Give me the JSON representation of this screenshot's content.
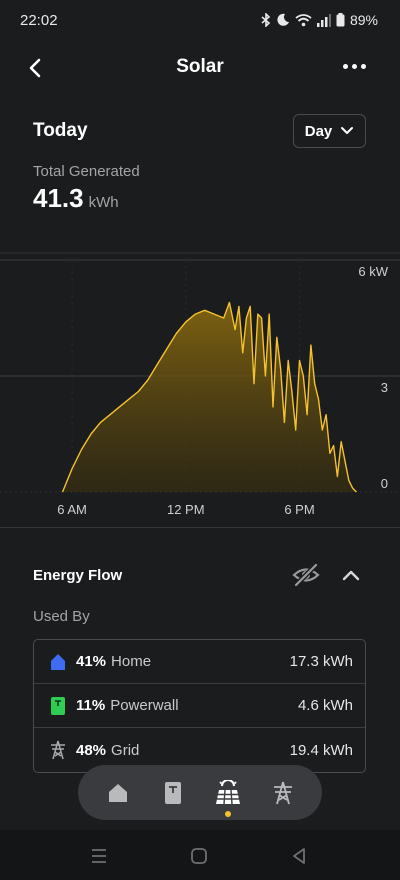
{
  "status_bar": {
    "time": "22:02",
    "battery": "89%",
    "icons": [
      "bluetooth-icon",
      "moon-icon",
      "wifi-icon",
      "signal-icon",
      "battery-icon"
    ]
  },
  "header": {
    "title": "Solar",
    "back_icon": "chevron-left-icon",
    "more_icon": "more-horizontal-icon"
  },
  "summary": {
    "period_title": "Today",
    "period_select": "Day",
    "total_label": "Total Generated",
    "total_value": "41.3",
    "total_unit": "kWh"
  },
  "chart_data": {
    "type": "area",
    "title": "",
    "xlabel": "",
    "ylabel": "",
    "x_ticks": [
      "6 AM",
      "12 PM",
      "6 PM"
    ],
    "y_ticks": [
      "0",
      "3",
      "6 kW"
    ],
    "ylim": [
      0,
      6
    ],
    "xlim_hours": [
      2.2,
      23.3
    ],
    "grid": true,
    "color": "#f5c22e",
    "series": [
      {
        "x": [
          5.5,
          6.0,
          6.5,
          7.0,
          7.5,
          8.0,
          8.5,
          9.0,
          9.5,
          10.0,
          10.5,
          11.0,
          11.5,
          12.0,
          12.5,
          13.0,
          13.5,
          14.0,
          14.3,
          14.6,
          14.8,
          15.0,
          15.2,
          15.4,
          15.6,
          15.8,
          16.0,
          16.2,
          16.4,
          16.6,
          16.8,
          17.0,
          17.2,
          17.4,
          17.6,
          17.8,
          18.0,
          18.2,
          18.4,
          18.6,
          18.8,
          19.0,
          19.2,
          19.4,
          19.6,
          19.8,
          20.0,
          20.2,
          20.4,
          20.6,
          20.8,
          21.0
        ],
        "values": [
          0.0,
          0.6,
          1.1,
          1.5,
          1.8,
          2.0,
          2.2,
          2.4,
          2.6,
          2.9,
          3.3,
          3.7,
          4.1,
          4.4,
          4.6,
          4.7,
          4.6,
          4.5,
          4.9,
          4.2,
          4.8,
          3.6,
          4.5,
          4.8,
          2.8,
          4.6,
          4.5,
          3.0,
          4.6,
          2.2,
          4.0,
          3.2,
          1.8,
          3.4,
          2.6,
          1.6,
          3.4,
          3.0,
          2.0,
          3.8,
          2.8,
          2.4,
          1.6,
          2.0,
          1.0,
          1.2,
          0.4,
          1.3,
          0.8,
          0.3,
          0.1,
          0.0
        ]
      }
    ]
  },
  "energy_flow": {
    "title": "Energy Flow",
    "hide_icon": "eye-off-icon",
    "collapse_icon": "chevron-up-icon",
    "used_by_label": "Used By",
    "rows": [
      {
        "icon": "home-icon",
        "icon_color": "#3f6bf0",
        "percent": "41%",
        "name": "Home",
        "value": "17.3 kWh"
      },
      {
        "icon": "powerwall-icon",
        "icon_color": "#2ecc52",
        "percent": "11%",
        "name": "Powerwall",
        "value": "4.6 kWh"
      },
      {
        "icon": "grid-tower-icon",
        "icon_color": "#a8a9ab",
        "percent": "48%",
        "name": "Grid",
        "value": "19.4 kWh"
      }
    ]
  },
  "bottom_tabs": {
    "items": [
      {
        "icon": "home-icon",
        "active": false
      },
      {
        "icon": "powerwall-icon",
        "active": false
      },
      {
        "icon": "solar-icon",
        "active": true
      },
      {
        "icon": "grid-tower-icon",
        "active": false
      }
    ],
    "active_color": "#f5c22e"
  },
  "system_nav": {
    "icons": [
      "recent-apps-icon",
      "home-button-icon",
      "back-triangle-icon"
    ]
  }
}
